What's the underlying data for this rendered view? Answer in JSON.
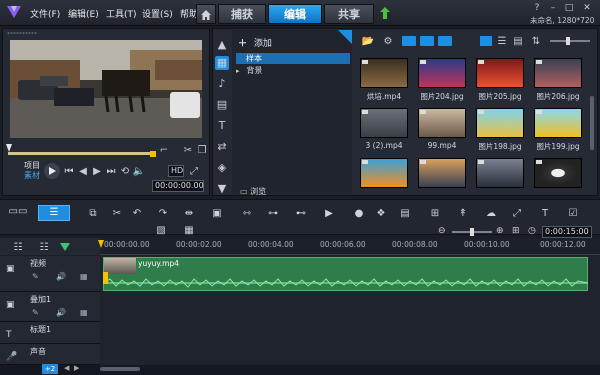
{
  "menu": {
    "file": "文件(F)",
    "edit": "编辑(E)",
    "tools": "工具(T)",
    "settings": "设置(S)",
    "help": "帮助"
  },
  "tabs": {
    "capture": "捕获",
    "edit": "编辑",
    "share": "共享"
  },
  "project_info": "未命名, 1280*720",
  "preview": {
    "mode_project": "项目",
    "mode_clip": "素材",
    "timecode": "00:00:00.00",
    "hd_badge": "HD"
  },
  "library": {
    "add_label": "添加",
    "folders": [
      "样本",
      "背景"
    ],
    "browse_label": "浏览",
    "items": [
      {
        "label": "烘培.mp4",
        "icon": "video-icon"
      },
      {
        "label": "图片204.jpg",
        "icon": "image-icon"
      },
      {
        "label": "图片205.jpg",
        "icon": "image-icon"
      },
      {
        "label": "图片206.jpg",
        "icon": "image-icon"
      },
      {
        "label": "3 (2).mp4",
        "icon": "video-icon"
      },
      {
        "label": "99.mp4",
        "icon": "video-icon"
      },
      {
        "label": "图片198.jpg",
        "icon": "image-icon"
      },
      {
        "label": "图片199.jpg",
        "icon": "image-icon"
      },
      {
        "label": "",
        "icon": "image-icon"
      },
      {
        "label": "",
        "icon": "image-icon"
      },
      {
        "label": "",
        "icon": "image-icon"
      },
      {
        "label": "",
        "icon": "audio-icon"
      }
    ]
  },
  "timeline": {
    "timecode": "0:00:15:00",
    "ruler": [
      "00:00:00.00",
      "00:00:02.00",
      "00:00:04.00",
      "00:00:06.00",
      "00:00:08.00",
      "00:00:10.00",
      "00:00:12.00"
    ],
    "tracks": [
      {
        "name": "视频",
        "kind": "video"
      },
      {
        "name": "叠加1",
        "kind": "overlay"
      },
      {
        "name": "标题1",
        "kind": "title"
      },
      {
        "name": "声音",
        "kind": "voice"
      }
    ],
    "clip_name": "yuyuy.mp4",
    "zoom_badge": "+2"
  },
  "colors": {
    "accent": "#1e8fe0",
    "clip_green": "#2f7d4a",
    "waveform": "#6fd08a"
  }
}
